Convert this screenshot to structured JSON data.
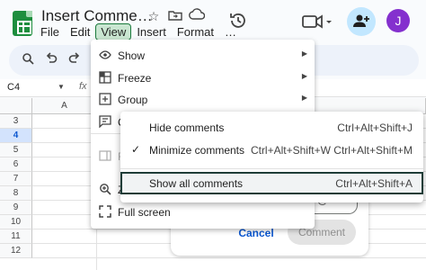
{
  "doc": {
    "title": "Insert Comme…"
  },
  "menubar": {
    "file": "File",
    "edit": "Edit",
    "view": "View",
    "insert": "Insert",
    "format": "Format",
    "more": "…"
  },
  "user": {
    "avatar_letter": "J"
  },
  "formula": {
    "cell": "C4",
    "fx": "fx"
  },
  "grid": {
    "col_a": "A",
    "rows": [
      "3",
      "4",
      "5",
      "6",
      "7",
      "8",
      "9",
      "10",
      "11",
      "12"
    ],
    "selected_row": "4"
  },
  "view_menu": {
    "items": [
      {
        "label": "Show",
        "icon": "eye-icon",
        "arrow": true
      },
      {
        "label": "Freeze",
        "icon": "freeze-icon",
        "arrow": true
      },
      {
        "label": "Group",
        "icon": "group-icon",
        "arrow": true
      },
      {
        "label": "C",
        "icon": "comment-icon",
        "arrow": false
      },
      {
        "label": "F",
        "icon": "panel-icon",
        "arrow": false
      },
      {
        "label": "Z",
        "icon": "zoom-icon",
        "arrow": false
      },
      {
        "label": "Full screen",
        "icon": "fullscreen-icon",
        "arrow": false
      }
    ]
  },
  "comments_menu": {
    "hide": {
      "label": "Hide comments",
      "shortcut": "Ctrl+Alt+Shift+J"
    },
    "minimize": {
      "label": "Minimize comments",
      "shortcut": "Ctrl+Alt+Shift+W Ctrl+Alt+Shift+M",
      "checked": true
    },
    "show_all": {
      "label": "Show all comments",
      "shortcut": "Ctrl+Alt+Shift+A"
    }
  },
  "comment_card": {
    "input_hint": "n @",
    "cancel": "Cancel",
    "comment": "Comment"
  }
}
